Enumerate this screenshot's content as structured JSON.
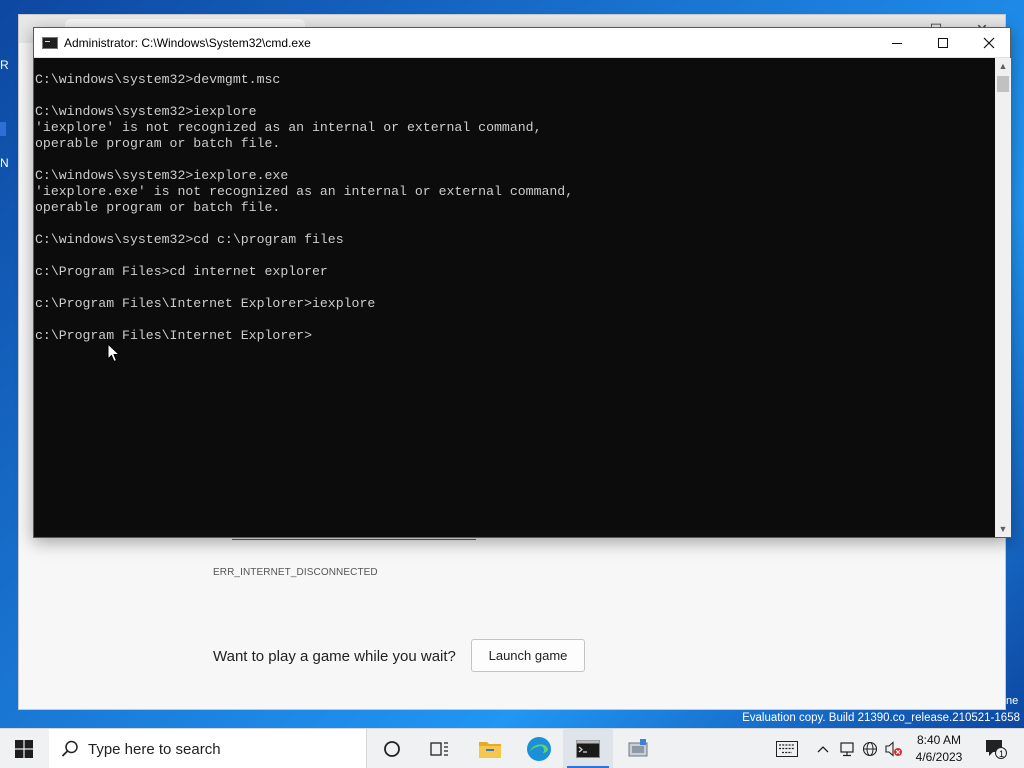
{
  "desktop": {
    "icon_stub_labels": [
      "R",
      "N"
    ]
  },
  "browser": {
    "error_code": "ERR_INTERNET_DISCONNECTED",
    "game_prompt": "Want to play a game while you wait?",
    "launch_game_label": "Launch game"
  },
  "cmd": {
    "title": "Administrator: C:\\Windows\\System32\\cmd.exe",
    "lines": [
      "C:\\windows\\system32>devmgmt.msc",
      "",
      "C:\\windows\\system32>iexplore",
      "'iexplore' is not recognized as an internal or external command,",
      "operable program or batch file.",
      "",
      "C:\\windows\\system32>iexplore.exe",
      "'iexplore.exe' is not recognized as an internal or external command,",
      "operable program or batch file.",
      "",
      "C:\\windows\\system32>cd c:\\program files",
      "",
      "c:\\Program Files>cd internet explorer",
      "",
      "c:\\Program Files\\Internet Explorer>iexplore",
      "",
      "c:\\Program Files\\Internet Explorer>"
    ]
  },
  "watermark": {
    "text": "Evaluation copy. Build 21390.co_release.210521-1658",
    "edge_fragment": "ne"
  },
  "taskbar": {
    "search_placeholder": "Type here to search",
    "clock_time": "8:40 AM",
    "clock_date": "4/6/2023",
    "notification_count": "1",
    "pinned": [
      "cortana-icon",
      "task-view-icon",
      "file-explorer-icon",
      "edge-icon",
      "command-prompt-icon",
      "app-icon"
    ]
  },
  "colors": {
    "console_bg": "#0c0c0c",
    "console_text": "#cccccc",
    "taskbar_bg": "#f0f1f3",
    "accent": "#2e73d8"
  }
}
